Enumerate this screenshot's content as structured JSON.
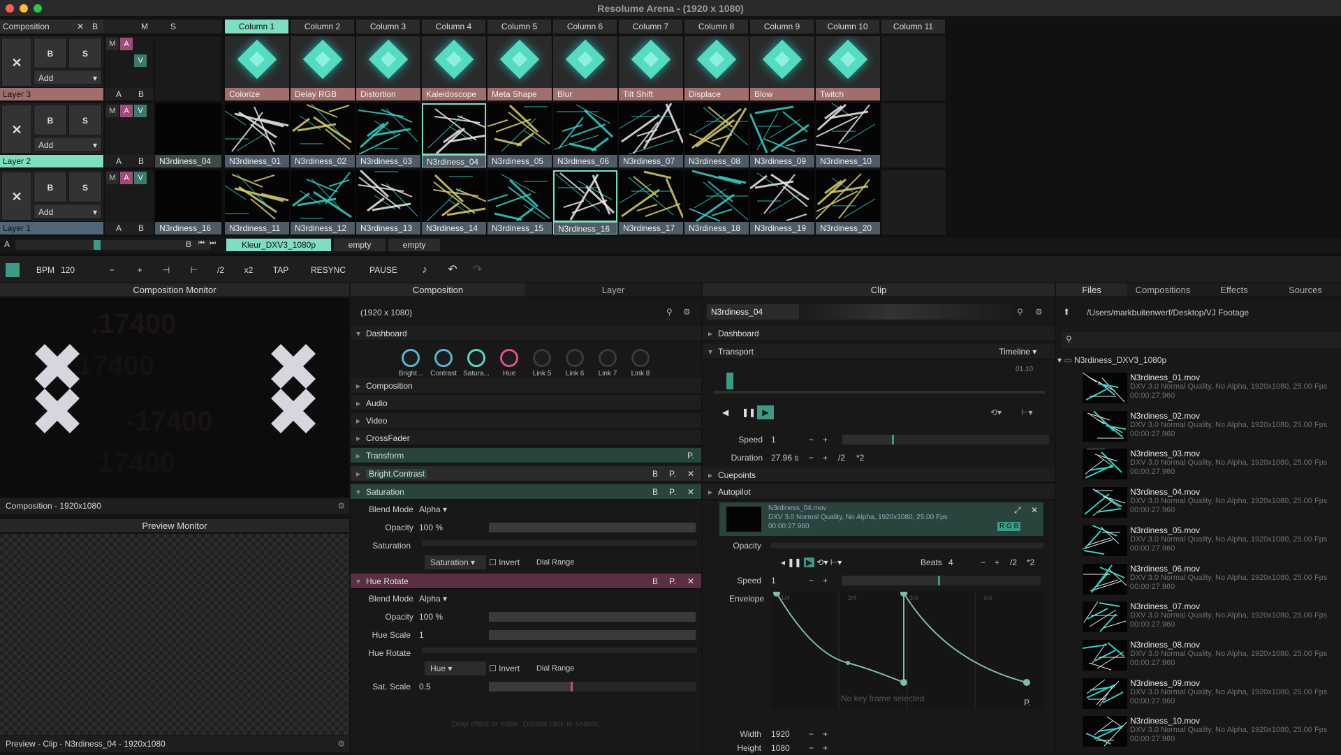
{
  "window": {
    "title": "Resolume Arena -   (1920 x 1080)",
    "traffic_colors": [
      "#ff5f57",
      "#febc2e",
      "#28c840"
    ]
  },
  "composition_header": {
    "label": "Composition",
    "x_label": "✕",
    "b_label": "B",
    "m_label": "M",
    "s_label": "S"
  },
  "columns": [
    "Column 1",
    "Column 2",
    "Column 3",
    "Column 4",
    "Column 5",
    "Column 6",
    "Column 7",
    "Column 8",
    "Column 9",
    "Column 10",
    "Column 11"
  ],
  "layers": [
    {
      "name": "Layer 3",
      "color": "#a06f6c",
      "add": "Add",
      "b": "B",
      "s": "S",
      "m": "M",
      "a": "A",
      "v": "V",
      "ab_a": "A",
      "ab_b": "B",
      "clips": [
        "Colorize",
        "Delay RGB",
        "Distortion",
        "Kaleidoscope",
        "Meta Shape",
        "Blur",
        "Tilt Shift",
        "Displace",
        "Blow",
        "Twitch"
      ]
    },
    {
      "name": "Layer 2",
      "color": "#7cdfc2",
      "add": "Add",
      "b": "B",
      "s": "S",
      "m": "M",
      "a": "A",
      "v": "V",
      "ab_a": "A",
      "ab_b": "B",
      "preview": "N3rdiness_04",
      "clips": [
        "N3rdiness_01",
        "N3rdiness_02",
        "N3rdiness_03",
        "N3rdiness_04",
        "N3rdiness_05",
        "N3rdiness_06",
        "N3rdiness_07",
        "N3rdiness_08",
        "N3rdiness_09",
        "N3rdiness_10"
      ]
    },
    {
      "name": "Layer 1",
      "color": "#4f6878",
      "add": "Add",
      "b": "B",
      "s": "S",
      "m": "M",
      "a": "A",
      "v": "V",
      "ab_a": "A",
      "ab_b": "B",
      "preview": "N3rdiness_16",
      "clips": [
        "N3rdiness_11",
        "N3rdiness_12",
        "N3rdiness_13",
        "N3rdiness_14",
        "N3rdiness_15",
        "N3rdiness_16",
        "N3rdiness_17",
        "N3rdiness_18",
        "N3rdiness_19",
        "N3rdiness_20"
      ]
    }
  ],
  "deck_bar": {
    "a": "A",
    "b": "B",
    "deck_tabs": [
      "Kleur_DXV3_1080p",
      "empty",
      "empty"
    ]
  },
  "toolbar": {
    "bpm_label": "BPM",
    "bpm_value": "120",
    "minus": "−",
    "plus": "+",
    "nudge_left": "⊣",
    "nudge_right": "⊢",
    "half": "/2",
    "double": "x2",
    "tap": "TAP",
    "resync": "RESYNC",
    "pause": "PAUSE"
  },
  "composition_monitor": {
    "title": "Composition Monitor",
    "footer": "Composition - 1920x1080"
  },
  "preview_monitor": {
    "title": "Preview Monitor",
    "footer": "Preview - Clip - N3rdiness_04 - 1920x1080"
  },
  "comp_panel": {
    "tabs": [
      "Composition",
      "Layer"
    ],
    "resolution": "(1920 x 1080)",
    "dashboard": "Dashboard",
    "knobs": [
      {
        "label": "Bright...",
        "color": "#54b8d6"
      },
      {
        "label": "Contrast",
        "color": "#54b8d6"
      },
      {
        "label": "Satura...",
        "color": "#53dcc0"
      },
      {
        "label": "Hue",
        "color": "#e0508f"
      },
      {
        "label": "Link 5",
        "color": "#3a3a3a"
      },
      {
        "label": "Link 6",
        "color": "#3a3a3a"
      },
      {
        "label": "Link 7",
        "color": "#3a3a3a"
      },
      {
        "label": "Link 8",
        "color": "#3a3a3a"
      }
    ],
    "sections": [
      "Composition",
      "Audio",
      "Video",
      "CrossFader",
      "Transform"
    ],
    "bright_contrast": "Bright.Contrast",
    "b": "B",
    "p": "P.",
    "x": "✕",
    "saturation": {
      "title": "Saturation",
      "blend_label": "Blend Mode",
      "blend_value": "Alpha",
      "opacity_label": "Opacity",
      "opacity_value": "100 %",
      "opacity_level": 1.0,
      "sat_label": "Saturation",
      "sat_select": "Saturation",
      "invert": "Invert",
      "dial_range": "Dial Range"
    },
    "hue_rotate": {
      "title": "Hue Rotate",
      "blend_label": "Blend Mode",
      "blend_value": "Alpha",
      "opacity_label": "Opacity",
      "opacity_value": "100 %",
      "opacity_level": 1.0,
      "hue_scale_label": "Hue Scale",
      "hue_scale_value": "1",
      "hue_scale_level": 1.0,
      "hue_rotate_label": "Hue Rotate",
      "hue_select": "Hue",
      "invert": "Invert",
      "dial_range": "Dial Range",
      "sat_scale_label": "Sat. Scale",
      "sat_scale_value": "0.5",
      "sat_scale_level": 0.5
    },
    "drop_hint": "Drop effect or mask. Double click to search."
  },
  "clip_panel": {
    "title": "Clip",
    "clip_name": "N3rdiness_04",
    "dashboard": "Dashboard",
    "transport": "Transport",
    "timeline": "Timeline",
    "time_readout": "01.10",
    "speed_label": "Speed",
    "speed_value": "1",
    "duration_label": "Duration",
    "duration_value": "27.96 s",
    "half": "/2",
    "double": "*2",
    "cuepoints": "Cuepoints",
    "autopilot": "Autopilot",
    "file_name": "N3rdiness_04.mov",
    "file_info": "DXV 3.0 Normal Quality, No Alpha, 1920x1080, 25.00 Fps",
    "file_dur": "00:00:27.960",
    "rgb": [
      "R",
      "G",
      "B"
    ],
    "opacity_label": "Opacity",
    "beats_label": "Beats",
    "beats_value": "4",
    "speed2_label": "Speed",
    "speed2_value": "1",
    "envelope_label": "Envelope",
    "envelope_ticks": [
      "1/4",
      "2/4",
      "3/4",
      "4/4"
    ],
    "no_key": "No key frame selected",
    "p": "P.",
    "width_label": "Width",
    "width_value": "1920",
    "height_label": "Height",
    "height_value": "1080"
  },
  "files_panel": {
    "tabs": [
      "Files",
      "Compositions",
      "Effects",
      "Sources"
    ],
    "path": "/Users/markbuitenwerf/Desktop/VJ Footage",
    "folder": "N3rdiness_DXV3_1080p",
    "files": [
      {
        "name": "N3rdiness_01.mov",
        "info": "DXV 3.0 Normal Quality, No Alpha, 1920x1080, 25.00 Fps",
        "dur": "00:00:27.960"
      },
      {
        "name": "N3rdiness_02.mov",
        "info": "DXV 3.0 Normal Quality, No Alpha, 1920x1080, 25.00 Fps",
        "dur": "00:00:27.960"
      },
      {
        "name": "N3rdiness_03.mov",
        "info": "DXV 3.0 Normal Quality, No Alpha, 1920x1080, 25.00 Fps",
        "dur": "00:00:27.960"
      },
      {
        "name": "N3rdiness_04.mov",
        "info": "DXV 3.0 Normal Quality, No Alpha, 1920x1080, 25.00 Fps",
        "dur": "00:00:27.960"
      },
      {
        "name": "N3rdiness_05.mov",
        "info": "DXV 3.0 Normal Quality, No Alpha, 1920x1080, 25.00 Fps",
        "dur": "00:00:27.960"
      },
      {
        "name": "N3rdiness_06.mov",
        "info": "DXV 3.0 Normal Quality, No Alpha, 1920x1080, 25.00 Fps",
        "dur": "00:00:27.960"
      },
      {
        "name": "N3rdiness_07.mov",
        "info": "DXV 3.0 Normal Quality, No Alpha, 1920x1080, 25.00 Fps",
        "dur": "00:00:27.960"
      },
      {
        "name": "N3rdiness_08.mov",
        "info": "DXV 3.0 Normal Quality, No Alpha, 1920x1080, 25.00 Fps",
        "dur": "00:00:27.960"
      },
      {
        "name": "N3rdiness_09.mov",
        "info": "DXV 3.0 Normal Quality, No Alpha, 1920x1080, 25.00 Fps",
        "dur": "00:00:27.960"
      },
      {
        "name": "N3rdiness_10.mov",
        "info": "DXV 3.0 Normal Quality, No Alpha, 1920x1080, 25.00 Fps",
        "dur": "00:00:27.960"
      }
    ]
  },
  "colors": {
    "accent": "#7cdfc2",
    "effect_red": "#a06f6c",
    "layer_blue": "#4f6878",
    "hue_magenta": "#5b2f42"
  }
}
